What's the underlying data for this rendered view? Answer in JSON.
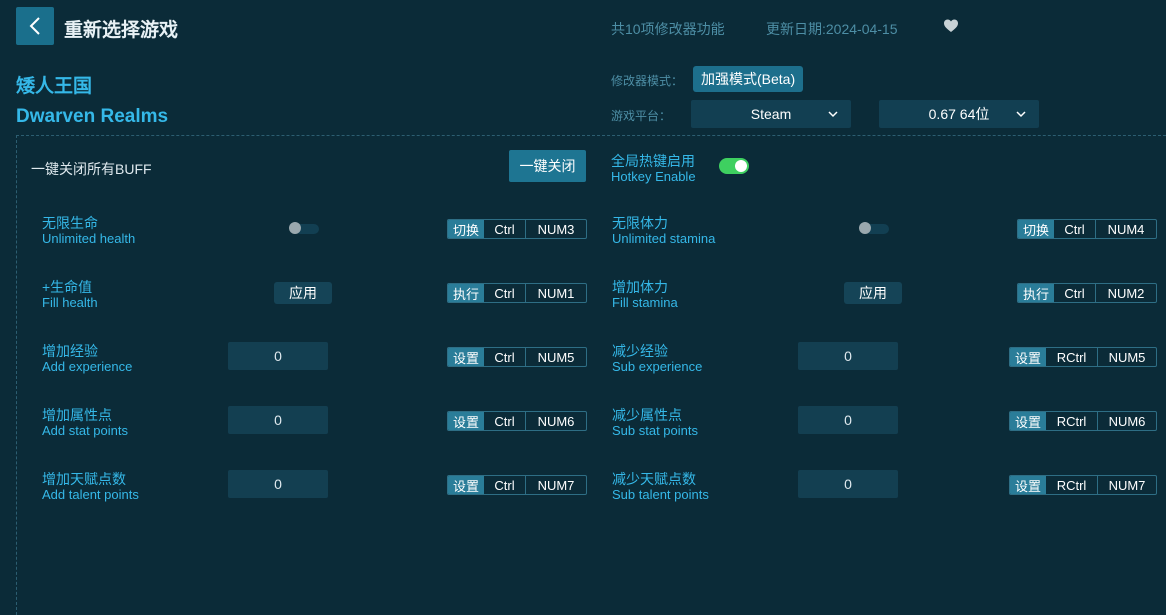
{
  "header": {
    "back_icon": "chevron-left-icon",
    "title": "重新选择游戏",
    "feature_count": "共10项修改器功能",
    "update_date": "更新日期:2024-04-15",
    "favorite_icon": "heart-icon"
  },
  "game": {
    "name_cn": "矮人王国",
    "name_en": "Dwarven Realms"
  },
  "settings": {
    "mode_label": "修改器模式：",
    "mode_value": "加强模式(Beta)",
    "platform_label": "游戏平台：",
    "platform_value": "Steam",
    "version_value": "0.67 64位"
  },
  "panel": {
    "close_all_label": "一键关闭所有BUFF",
    "close_all_button": "一键关闭",
    "hotkey_cn": "全局热键启用",
    "hotkey_en": "Hotkey Enable",
    "hotkey_enabled": true
  },
  "features": {
    "left": [
      {
        "cn": "无限生命",
        "en": "Unlimited health",
        "control": "toggle",
        "enabled": false,
        "hk_action": "切换",
        "hk_mod": "Ctrl",
        "hk_key": "NUM3"
      },
      {
        "cn": "+生命值",
        "en": "Fill health",
        "control": "apply",
        "button": "应用",
        "hk_action": "执行",
        "hk_mod": "Ctrl",
        "hk_key": "NUM1"
      },
      {
        "cn": "增加经验",
        "en": "Add experience",
        "control": "input",
        "value": "0",
        "hk_action": "设置",
        "hk_mod": "Ctrl",
        "hk_key": "NUM5"
      },
      {
        "cn": "增加属性点",
        "en": "Add stat points",
        "control": "input",
        "value": "0",
        "hk_action": "设置",
        "hk_mod": "Ctrl",
        "hk_key": "NUM6"
      },
      {
        "cn": "增加天赋点数",
        "en": "Add talent points",
        "control": "input",
        "value": "0",
        "hk_action": "设置",
        "hk_mod": "Ctrl",
        "hk_key": "NUM7"
      }
    ],
    "right": [
      {
        "cn": "无限体力",
        "en": "Unlimited stamina",
        "control": "toggle",
        "enabled": false,
        "hk_action": "切换",
        "hk_mod": "Ctrl",
        "hk_key": "NUM4"
      },
      {
        "cn": "增加体力",
        "en": "Fill stamina",
        "control": "apply",
        "button": "应用",
        "hk_action": "执行",
        "hk_mod": "Ctrl",
        "hk_key": "NUM2"
      },
      {
        "cn": "减少经验",
        "en": "Sub experience",
        "control": "input",
        "value": "0",
        "hk_action": "设置",
        "hk_mod": "RCtrl",
        "hk_key": "NUM5"
      },
      {
        "cn": "减少属性点",
        "en": "Sub stat points",
        "control": "input",
        "value": "0",
        "hk_action": "设置",
        "hk_mod": "RCtrl",
        "hk_key": "NUM6"
      },
      {
        "cn": "减少天赋点数",
        "en": "Sub talent points",
        "control": "input",
        "value": "0",
        "hk_action": "设置",
        "hk_mod": "RCtrl",
        "hk_key": "NUM7"
      }
    ]
  },
  "colors": {
    "background": "#0b2b38",
    "accent": "#35b8e8",
    "button": "#1e7592",
    "toggle_on": "#3ed060"
  }
}
